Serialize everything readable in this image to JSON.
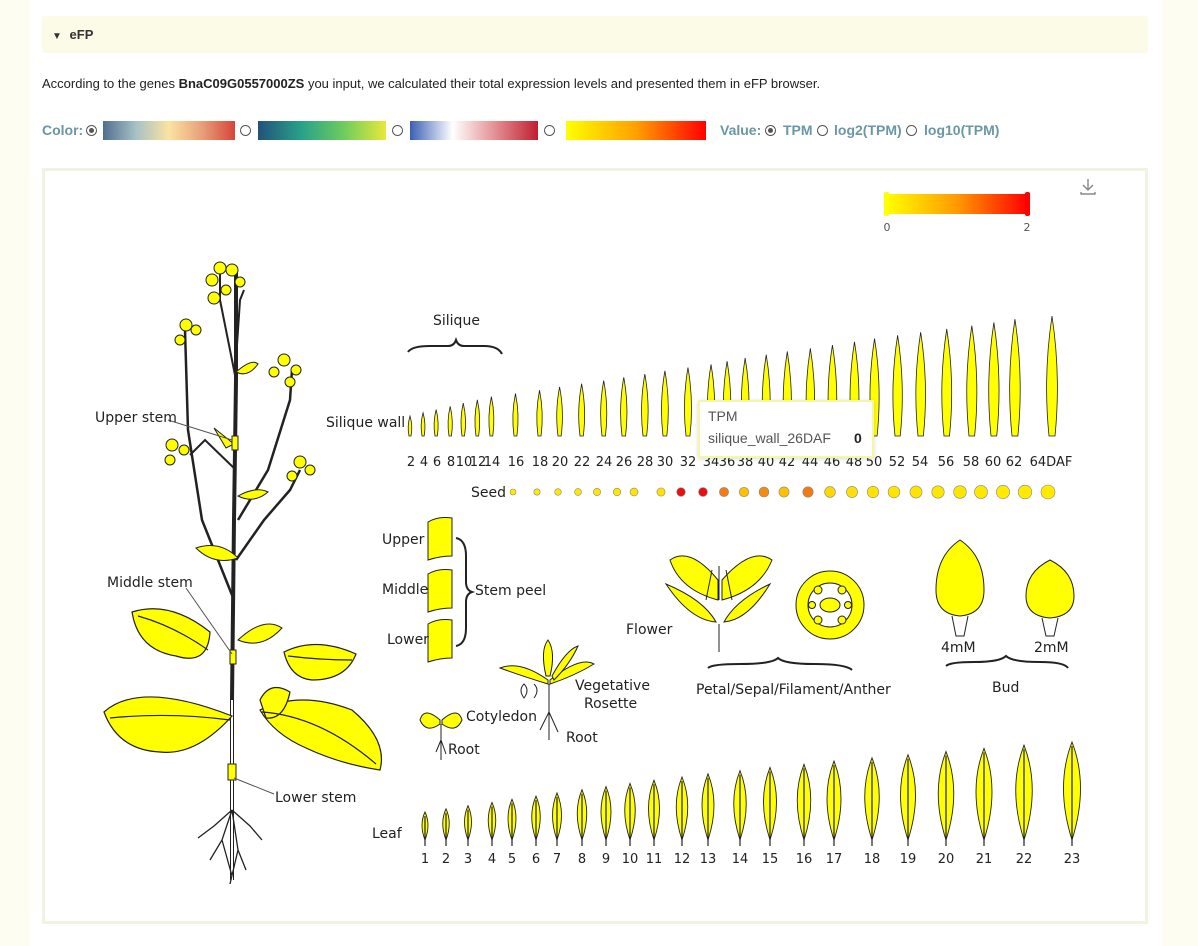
{
  "section": {
    "toggle": "▼",
    "title": "eFP"
  },
  "description": {
    "prefix": "According to the genes ",
    "gene": "BnaC09G0557000ZS",
    "suffix": " you input, we calculated their total expression levels and presented them in eFP browser."
  },
  "controls": {
    "color_label": "Color:",
    "palettes": [
      {
        "colors": [
          "#4f6f8f",
          "#a8c1c6",
          "#fbe3a0",
          "#e7a07a",
          "#d9443a"
        ],
        "selected": true
      },
      {
        "colors": [
          "#23527a",
          "#27a08a",
          "#6ccc5e",
          "#e8e83a"
        ],
        "selected": false
      },
      {
        "colors": [
          "#3a5fb5",
          "#ffffff",
          "#e28f93",
          "#c01f30"
        ],
        "selected": false
      },
      {
        "colors": [
          "#ffff00",
          "#ffa000",
          "#ff0000"
        ],
        "selected": false
      }
    ],
    "value_label": "Value:",
    "value_options": [
      {
        "label": "TPM",
        "selected": true
      },
      {
        "label": "log2(TPM)",
        "selected": false
      },
      {
        "label": "log10(TPM)",
        "selected": false
      }
    ]
  },
  "legend": {
    "min": "0",
    "max": "2",
    "colors": [
      "#ffff00",
      "#ff9a00",
      "#ff0000"
    ]
  },
  "download_icon": "download-icon",
  "labels": {
    "silique": "Silique",
    "silique_wall": "Silique wall",
    "seed": "Seed",
    "upper_stem": "Upper stem",
    "middle_stem": "Middle stem",
    "lower_stem": "Lower stem",
    "upper": "Upper",
    "middle": "Middle",
    "lower": "Lower",
    "stem_peel": "Stem peel",
    "flower": "Flower",
    "petal": "Petal/Sepal/Filament/Anther",
    "bud": "Bud",
    "bud_4mm": "4mM",
    "bud_2mm": "2mM",
    "vegetative": "Vegetative",
    "rosette": "Rosette",
    "cotyledon": "Cotyledon",
    "root1": "Root",
    "root2": "Root",
    "leaf": "Leaf"
  },
  "silique_ticks": [
    "2",
    "4",
    "6",
    "8",
    "10",
    "12",
    "14",
    "16",
    "18",
    "20",
    "22",
    "24",
    "26",
    "28",
    "30",
    "32",
    "34",
    "36",
    "38",
    "40",
    "42",
    "44",
    "46",
    "48",
    "50",
    "52",
    "54",
    "56",
    "58",
    "60",
    "62",
    "64DAF"
  ],
  "seed_colors": [
    "#ffea00",
    "#ffea00",
    "#ffe800",
    "#ffe800",
    "#ffe600",
    "#ffe600",
    "#ffe400",
    "#ffe000",
    "#e81010",
    "#e81010",
    "#f57a10",
    "#ffc000",
    "#f58a10",
    "#ffc000",
    "#f07a10",
    "#ffd800",
    "#ffe000",
    "#ffe200",
    "#ffe400",
    "#ffe400",
    "#ffe600",
    "#ffe600",
    "#ffe800",
    "#ffea00",
    "#ffea00",
    "#ffea00",
    "#ffe800"
  ],
  "leaf_ticks": [
    "1",
    "2",
    "3",
    "4",
    "5",
    "6",
    "7",
    "8",
    "9",
    "10",
    "11",
    "12",
    "13",
    "14",
    "15",
    "16",
    "17",
    "18",
    "19",
    "20",
    "21",
    "22",
    "23"
  ],
  "tooltip": {
    "title": "TPM",
    "sample": "silique_wall_26DAF",
    "value": "0"
  },
  "tissue_color": "#ffff00"
}
